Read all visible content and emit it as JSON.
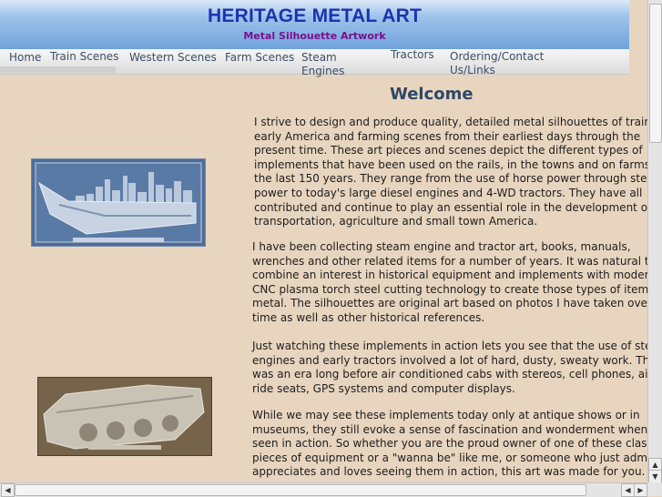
{
  "header": {
    "title": "HERITAGE METAL ART",
    "subtitle": "Metal Silhouette Artwork"
  },
  "nav": {
    "home": "Home",
    "train": "Train Scenes",
    "western": "Western Scenes",
    "farm": "Farm Scenes",
    "steam_1": "Steam",
    "steam_2": "Engines",
    "tractors": "Tractors",
    "ordering_1": "Ordering/Contact",
    "ordering_2": "Us/Links"
  },
  "main": {
    "heading": "Welcome",
    "p1": [
      "I strive to design and produce quality, detailed metal silhouettes of trains,",
      "early America and farming scenes from their earliest days through the",
      "present time. These art pieces and scenes depict the different types of",
      "implements that have been used on the rails, in the towns and on farms over",
      "the last 150 years. They range from the use of horse power through steam",
      "power to today's large diesel engines and 4-WD tractors. They have all",
      "contributed and continue to play an essential role in the development of",
      "transportation, agriculture and small town America."
    ],
    "p2": [
      "I have been collecting steam engine and tractor art, books, manuals,",
      "wrenches and other related items for a number of years. It was natural to",
      "combine an interest in historical equipment and implements with modern",
      "CNC plasma torch steel cutting technology to create those types of items in",
      "metal. The silhouettes are original art based on photos I have taken over",
      "time as well as other historical references."
    ],
    "p3": [
      "Just watching these implements in action lets you see that the use of steam",
      "engines and early tractors involved a lot of hard, dusty, sweaty work. This",
      "was an era long before air conditioned cabs with stereos, cell phones, air-",
      "ride seats, GPS systems and computer displays."
    ],
    "p4": [
      "While we may see these implements today only at antique shows or in",
      "museums, they still evoke a sense of fascination and wonderment when",
      "seen in action. So whether you are the proud owner of one of these classic",
      "pieces of equipment or a \"wanna be\" like me, or someone who just admires,",
      "appreciates and loves seeing them in action, this art was made for you. I"
    ]
  },
  "colors": {
    "page_bg": "#e8d5bf",
    "title": "#1b34b0",
    "subtitle": "#7a0f8c",
    "nav_text": "#3a4f66",
    "heading": "#2f4766"
  },
  "icons": {
    "scroll_up": "▲",
    "scroll_down": "▼",
    "scroll_left": "◀",
    "scroll_right": "▶"
  }
}
